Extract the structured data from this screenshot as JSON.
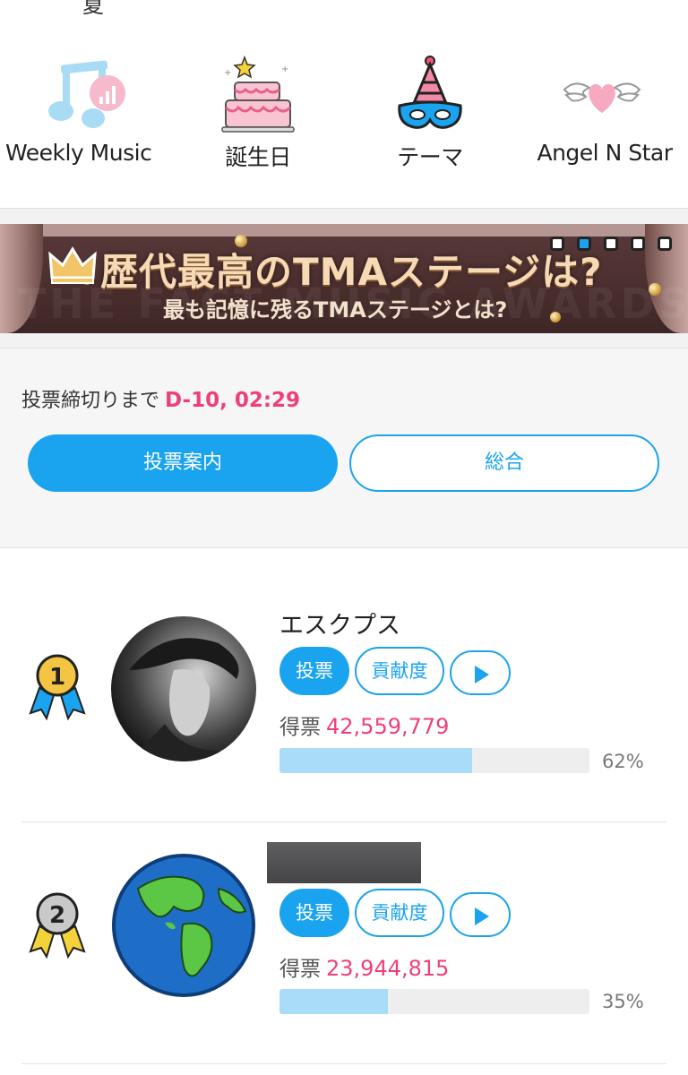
{
  "top_cut_text": "夏",
  "categories": [
    {
      "label": "Weekly Music",
      "icon": "music-note-chart-icon"
    },
    {
      "label": "誕生日",
      "icon": "birthday-cake-icon"
    },
    {
      "label": "テーマ",
      "icon": "party-hat-mask-icon"
    },
    {
      "label": "Angel N Star",
      "icon": "winged-heart-icon"
    }
  ],
  "banner": {
    "title": "歴代最高のTMAステージは?",
    "subtitle": "最も記憶に残るTMAステージとは?",
    "watermark": "THE FACT MUSIC AWARDS",
    "slides": 5,
    "active_slide": 2
  },
  "deadline": {
    "label": "投票締切りまで",
    "countdown": "D-10, 02:29"
  },
  "buttons": {
    "guide": "投票案内",
    "total": "総合"
  },
  "ranking": [
    {
      "rank": "1",
      "name": "エスクプス",
      "vote_label": "投票",
      "contrib_label": "貢献度",
      "votes_label": "得票",
      "votes": "42,559,779",
      "percent": "62%",
      "percent_value": 0.62
    },
    {
      "rank": "2",
      "name": "",
      "vote_label": "投票",
      "contrib_label": "貢献度",
      "votes_label": "得票",
      "votes": "23,944,815",
      "percent": "35%",
      "percent_value": 0.35
    }
  ],
  "colors": {
    "accent": "#1aa3ee",
    "highlight": "#ee3f7d",
    "bar_fill": "#a8dcf8"
  }
}
